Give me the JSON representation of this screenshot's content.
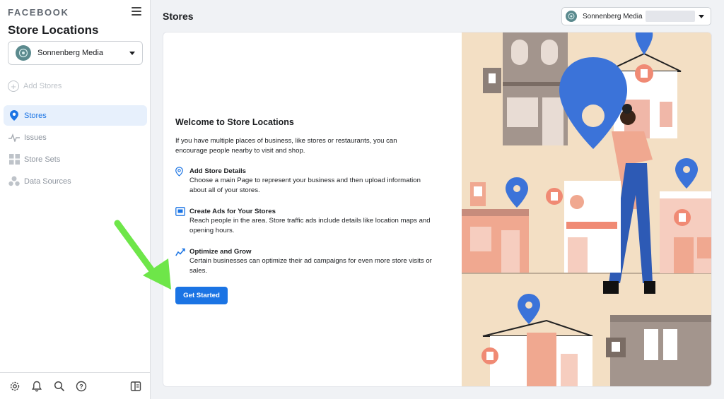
{
  "sidebar": {
    "brand": "FACEBOOK",
    "title": "Store Locations",
    "account": {
      "name": "Sonnenberg Media"
    },
    "add_stores": "Add Stores",
    "items": [
      {
        "label": "Stores",
        "icon": "location-pin-icon",
        "active": true
      },
      {
        "label": "Issues",
        "icon": "pulse-icon",
        "active": false
      },
      {
        "label": "Store Sets",
        "icon": "grid-icon",
        "active": false
      },
      {
        "label": "Data Sources",
        "icon": "data-sources-icon",
        "active": false
      }
    ],
    "footer_icons": [
      "gear-icon",
      "bell-icon",
      "search-icon",
      "help-icon",
      "panel-toggle-icon"
    ]
  },
  "header": {
    "title": "Stores",
    "account_name": "Sonnenberg Media"
  },
  "main": {
    "welcome_title": "Welcome to Store Locations",
    "intro": "If you have multiple places of business, like stores or restaurants, you can encourage people nearby to visit and shop.",
    "features": [
      {
        "icon": "location-pin-icon",
        "title": "Add Store Details",
        "desc": "Choose a main Page to represent your business and then upload information about all of your stores."
      },
      {
        "icon": "ad-screen-icon",
        "title": "Create Ads for Your Stores",
        "desc": "Reach people in the area. Store traffic ads include details like location maps and opening hours."
      },
      {
        "icon": "trend-chart-icon",
        "title": "Optimize and Grow",
        "desc": "Certain businesses can optimize their ad campaigns for even more store visits or sales."
      }
    ],
    "cta_label": "Get Started"
  },
  "colors": {
    "accent": "#1b74e4",
    "illustration_bg": "#f3dfc4",
    "annotation_arrow": "#6ee649"
  }
}
